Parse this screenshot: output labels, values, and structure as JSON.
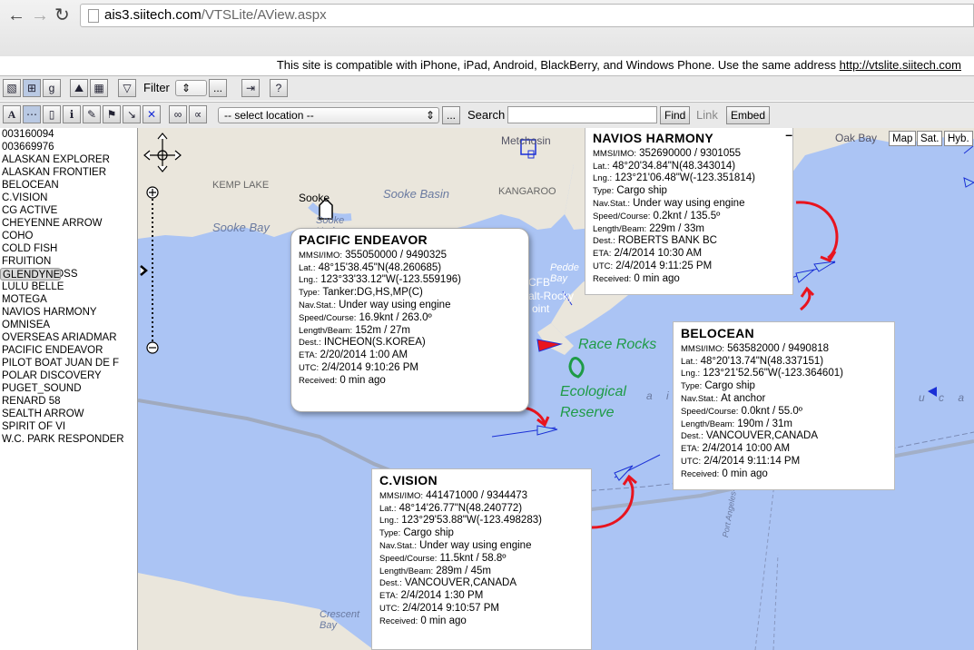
{
  "browser": {
    "url_host": "ais3.siitech.com",
    "url_path": "/VTSLite/AView.aspx"
  },
  "notice": {
    "text": "This site is compatible with iPhone, iPad, Android, BlackBerry, and Windows Phone. Use the same address",
    "link": "http://vtslite.siitech.com"
  },
  "toolbar1": {
    "filter_label": "Filter",
    "filter_more": "..."
  },
  "toolbar2": {
    "location_placeholder": "-- select location --",
    "location_more": "...",
    "search_label": "Search",
    "search_value": "",
    "find_label": "Find",
    "link_label": "Link",
    "embed_label": "Embed"
  },
  "ships": [
    "003160094",
    "003669976",
    "ALASKAN EXPLORER",
    "ALASKAN FRONTIER",
    "BELOCEAN",
    "C.VISION",
    "CG ACTIVE",
    "CHEYENNE ARROW",
    "COHO",
    "COLD FISH",
    "FRUITION",
    "GLENDYNE",
    "LINDSEY FOSS",
    "LULU BELLE",
    "MOTEGA",
    "NAVIOS HARMONY",
    "OMNISEA",
    "OVERSEAS ARIADMAR",
    "PACIFIC ENDEAVOR",
    "PILOT BOAT JUAN DE F",
    "POLAR DISCOVERY",
    "PUGET_SOUND",
    "RENARD 58",
    "SEALTH ARROW",
    "SPIRIT OF VI",
    "W.C. PARK RESPONDER"
  ],
  "selected_ship": "GLENDYNE",
  "map": {
    "types": [
      "Map",
      "Sat.",
      "Hyb."
    ],
    "labels": {
      "metchosin": "Metchosin",
      "oak_bay": "Oak Bay",
      "kemp_lake": "KEMP LAKE",
      "sooke": "Sooke",
      "sooke_basin": "Sooke Basin",
      "kangaroo": "KANGAROO",
      "sooke_harbour": "Sooke\nHarbour",
      "sooke_bay": "Sooke Bay",
      "pedder_bay": "Pedde\nBay",
      "cfb": "CFB",
      "salt_rocky": "alt-Rocky",
      "point": "oint",
      "crescent_bay": "Crescent\nBay",
      "ferry": "Port Angeles-Victoria BC Ferry",
      "strait_a": "a i t",
      "strait_b": "u c a"
    },
    "annotations": {
      "race_rocks": "Race Rocks",
      "eco1": "Ecological",
      "eco2": "Reserve"
    }
  },
  "infowindows": {
    "navios": {
      "name": "NAVIOS HARMONY",
      "mmsi": "352690000 / 9301055",
      "lat": "48°20'34.84\"N(48.343014)",
      "lng": "123°21'06.48\"W(-123.351814)",
      "type": "Cargo ship",
      "nav": "Under way using engine",
      "speed": "0.2knt / 135.5º",
      "dims": "229m / 33m",
      "dest": "ROBERTS BANK BC",
      "eta": "2/4/2014 10:30 AM",
      "utc": "2/4/2014 9:11:25 PM",
      "received": "0 min ago"
    },
    "pacific": {
      "name": "PACIFIC ENDEAVOR",
      "mmsi": "355050000 / 9490325",
      "lat": "48°15'38.45\"N(48.260685)",
      "lng": "123°33'33.12\"W(-123.559196)",
      "type": "Tanker:DG,HS,MP(C)",
      "nav": "Under way using engine",
      "speed": "16.9knt / 263.0º",
      "dims": "152m / 27m",
      "dest": "INCHEON(S.KOREA)",
      "eta": "2/20/2014 1:00 AM",
      "utc": "2/4/2014 9:10:26 PM",
      "received": "0 min ago"
    },
    "belocean": {
      "name": "BELOCEAN",
      "mmsi": "563582000 / 9490818",
      "lat": "48°20'13.74\"N(48.337151)",
      "lng": "123°21'52.56\"W(-123.364601)",
      "type": "Cargo ship",
      "nav": "At anchor",
      "speed": "0.0knt / 55.0º",
      "dims": "190m / 31m",
      "dest": "VANCOUVER,CANADA",
      "eta": "2/4/2014 10:00 AM",
      "utc": "2/4/2014 9:11:14 PM",
      "received": "0 min ago"
    },
    "cvision": {
      "name": "C.VISION",
      "mmsi": "441471000 / 9344473",
      "lat": "48°14'26.77\"N(48.240772)",
      "lng": "123°29'53.88\"W(-123.498283)",
      "type": "Cargo ship",
      "nav": "Under way using engine",
      "speed": "11.5knt / 58.8º",
      "dims": "289m / 45m",
      "dest": "VANCOUVER,CANADA",
      "eta": "2/4/2014 1:30 PM",
      "utc": "2/4/2014 9:10:57 PM",
      "received": "0 min ago"
    }
  },
  "field_labels": {
    "mmsi": "MMSI/IMO:",
    "lat": "Lat.:",
    "lng": "Lng.:",
    "type": "Type:",
    "nav": "Nav.Stat.:",
    "speed": "Speed/Course:",
    "dims": "Length/Beam:",
    "dest": "Dest.:",
    "eta": "ETA:",
    "utc": "UTC:",
    "received": "Received:"
  },
  "colors": {
    "water": "#abc4f4",
    "land": "#eae6dc",
    "annotation_red": "#e8141e",
    "annotation_green": "#1e9b46",
    "vessel_blue": "#1a2fd6"
  }
}
